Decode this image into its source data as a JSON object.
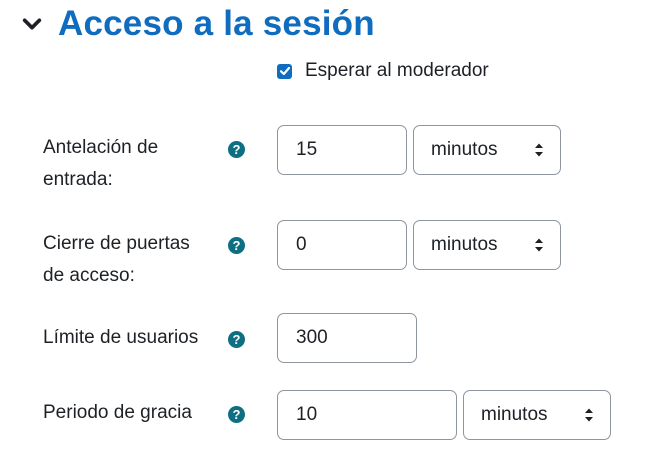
{
  "section": {
    "title": "Acceso a la sesión",
    "icon": "chevron-down-icon",
    "accent_color": "#0f6cbf"
  },
  "moderator_wait": {
    "label": "Esperar al moderador",
    "checked": true
  },
  "fields": {
    "entry_lead": {
      "label_line1": "Antelación de",
      "label_line2": "entrada:",
      "value": "15",
      "unit": "minutos"
    },
    "close_doors": {
      "label_line1": "Cierre de puertas",
      "label_line2": "de acceso:",
      "value": "0",
      "unit": "minutos"
    },
    "user_limit": {
      "label": "Límite de usuarios",
      "value": "300"
    },
    "grace_period": {
      "label": "Periodo de gracia",
      "value": "10",
      "unit": "minutos"
    }
  },
  "help_icon": {
    "glyph": "?",
    "icon": "question-circle-icon",
    "color": "#0f6f82"
  }
}
